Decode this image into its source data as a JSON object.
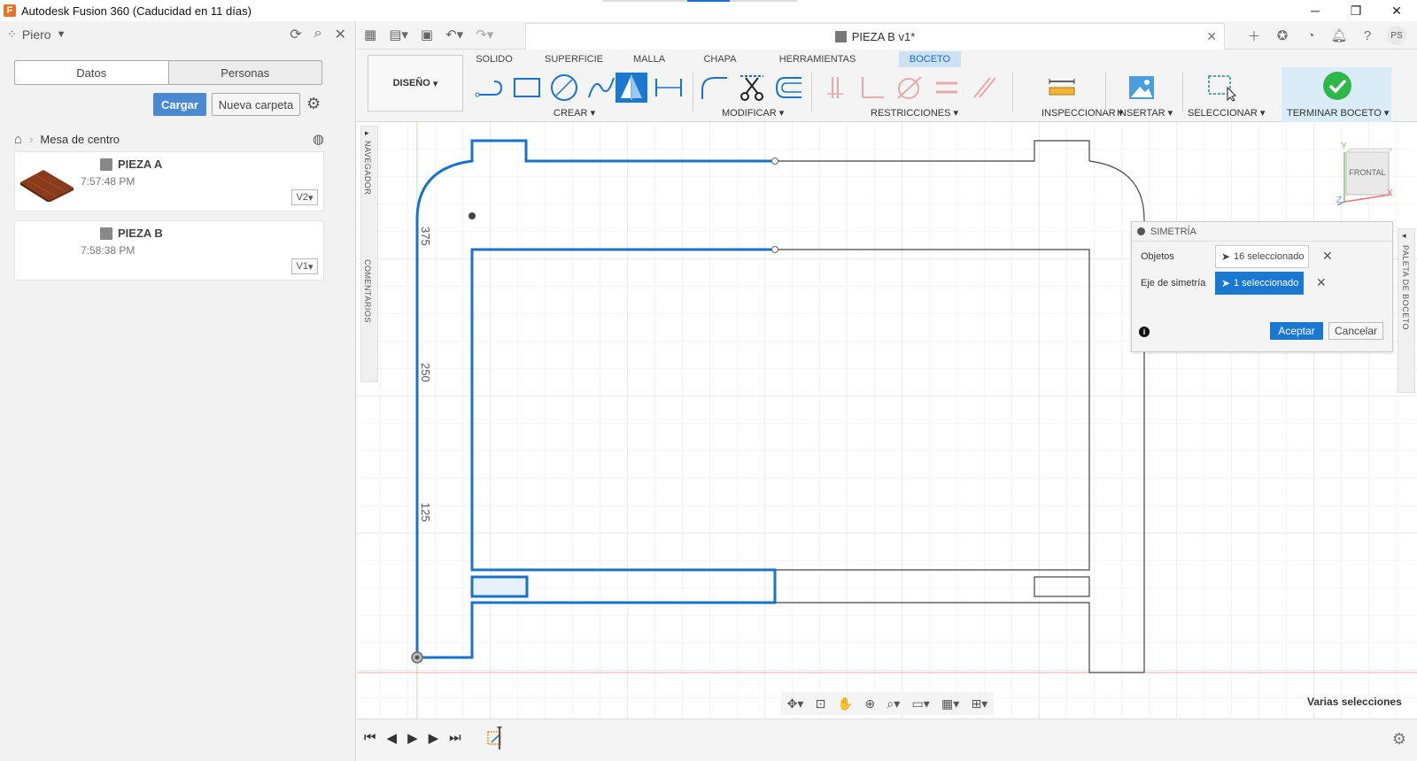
{
  "window": {
    "title": "Autodesk Fusion 360 (Caducidad en 11 días)",
    "logo_letter": "F",
    "minimize": "─",
    "restore": "❐",
    "close": "✕"
  },
  "left_panel": {
    "user": "Piero",
    "tabs": [
      "Datos",
      "Personas"
    ],
    "upload_button": "Cargar",
    "new_folder_button": "Nueva carpeta",
    "breadcrumb": "Mesa de centro",
    "files": [
      {
        "name": "PIEZA A",
        "time": "7:57:48 PM",
        "version": "V2"
      },
      {
        "name": "PIEZA B",
        "time": "7:58:38 PM",
        "version": "V1"
      }
    ]
  },
  "document": {
    "tab_title": "PIEZA B v1*",
    "avatar": "PS"
  },
  "ribbon": {
    "tabs": [
      "SOLIDO",
      "SUPERFICIE",
      "MALLA",
      "CHAPA",
      "HERRAMIENTAS",
      "BOCETO"
    ],
    "active_tab": "BOCETO",
    "workspace": "DISEÑO",
    "groups": [
      "CREAR",
      "MODIFICAR",
      "RESTRICCIONES",
      "INSPECCIONAR",
      "INSERTAR",
      "SELECCIONAR",
      "TERMINAR BOCETO"
    ]
  },
  "side_labels": {
    "navigator": "NAVEGADOR",
    "comments": "COMENTARIOS",
    "sketch_palette": "PALETA DE BOCETO"
  },
  "dimensions": [
    "375",
    "250",
    "125"
  ],
  "dialog": {
    "title": "SIMETRÍA",
    "objects_label": "Objetos",
    "objects_value": "16 seleccionado",
    "axis_label": "Eje de simetría",
    "axis_value": "1 seleccionado",
    "ok": "Aceptar",
    "cancel": "Cancelar"
  },
  "viewcube": {
    "face": "FRONTAL",
    "x": "X",
    "y": "Y",
    "z": "Z"
  },
  "status": "Varias selecciones",
  "colors": {
    "accent": "#1a78d0",
    "sketch_blue": "#1a73c9",
    "line": "#444444"
  }
}
